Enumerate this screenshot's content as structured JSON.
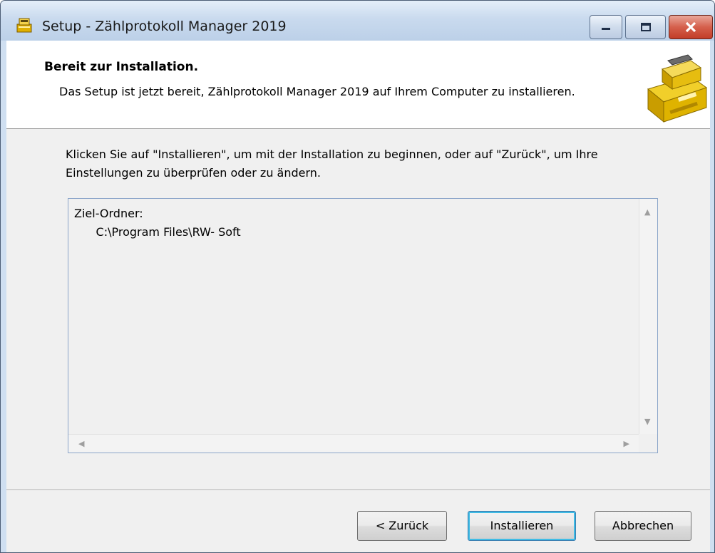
{
  "window": {
    "title": "Setup - Zählprotokoll Manager 2019",
    "app_icon": "cash-register-icon",
    "controls": [
      "minimize-icon",
      "maximize-icon",
      "close-icon"
    ]
  },
  "header": {
    "title": "Bereit zur Installation.",
    "description": "Das Setup ist jetzt bereit, Zählprotokoll Manager 2019 auf Ihrem Computer zu installieren.",
    "logo": "cash-register-icon"
  },
  "intro": "Klicken Sie auf \"Installieren\", um mit der Installation zu beginnen, oder auf \"Zurück\", um Ihre Einstellungen zu überprüfen oder zu ändern.",
  "memo": {
    "label": "Ziel-Ordner:",
    "value": "C:\\Program Files\\RW- Soft"
  },
  "buttons": {
    "back": "< Zurück",
    "install": "Installieren",
    "cancel": "Abbrechen"
  },
  "colors": {
    "header_bg": "#ffffff",
    "client_bg": "#f0f0f0",
    "default_button_focus": "#3fbce5"
  }
}
